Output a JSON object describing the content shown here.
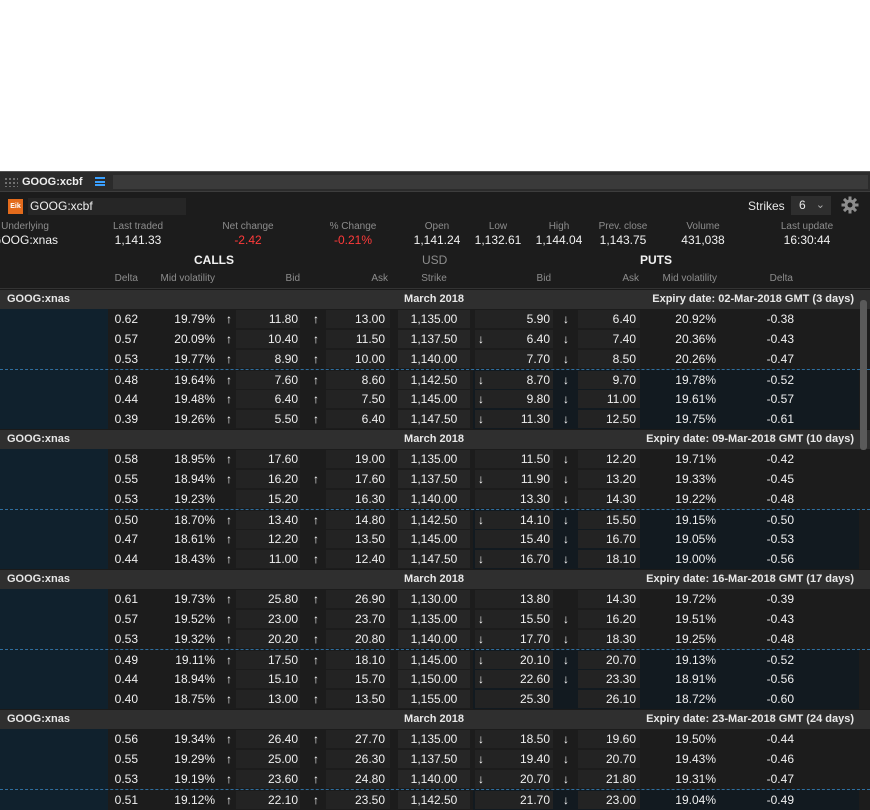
{
  "window": {
    "tab_title": "GOOG:xcbf",
    "symbol": "GOOG:xcbf",
    "logo_text": "Eik"
  },
  "toolbar": {
    "strikes_label": "Strikes",
    "strikes_value": "6"
  },
  "stats": [
    {
      "label": "Underlying",
      "value": "GOOG:xnas"
    },
    {
      "label": "Last traded",
      "value": "1,141.33"
    },
    {
      "label": "Net change",
      "value": "-2.42",
      "negative": true
    },
    {
      "label": "% Change",
      "value": "-0.21%",
      "negative": true
    },
    {
      "label": "Open",
      "value": "1,141.24"
    },
    {
      "label": "Low",
      "value": "1,132.61"
    },
    {
      "label": "High",
      "value": "1,144.04"
    },
    {
      "label": "Prev. close",
      "value": "1,143.75"
    },
    {
      "label": "Volume",
      "value": "431,038"
    },
    {
      "label": "Last update",
      "value": "16:30:44"
    }
  ],
  "sections": {
    "calls": "CALLS",
    "currency": "USD",
    "puts": "PUTS"
  },
  "columns": {
    "delta": "Delta",
    "mid_vol": "Mid volatility",
    "bid": "Bid",
    "ask": "Ask",
    "strike": "Strike",
    "p_bid": "Bid",
    "p_ask": "Ask",
    "p_mid_vol": "Mid volatility",
    "p_delta": "Delta"
  },
  "groups": [
    {
      "underlying": "GOOG:xnas",
      "month": "March 2018",
      "expiry": "Expiry date: 02-Mar-2018 GMT (3 days)",
      "rows": [
        {
          "delta": "0.62",
          "vol": "19.79%",
          "ca1": "up",
          "bid": "11.80",
          "ca2": "up",
          "ask": "13.00",
          "strike": "1,135.00",
          "pa1": "",
          "pbid": "5.90",
          "pa2": "down",
          "pask": "6.40",
          "pvol": "20.92%",
          "pdelta": "-0.38"
        },
        {
          "delta": "0.57",
          "vol": "20.09%",
          "ca1": "up",
          "bid": "10.40",
          "ca2": "up",
          "ask": "11.50",
          "strike": "1,137.50",
          "pa1": "down",
          "pbid": "6.40",
          "pa2": "down",
          "pask": "7.40",
          "pvol": "20.36%",
          "pdelta": "-0.43"
        },
        {
          "delta": "0.53",
          "vol": "19.77%",
          "ca1": "up",
          "bid": "8.90",
          "ca2": "up",
          "ask": "10.00",
          "strike": "1,140.00",
          "pa1": "",
          "pbid": "7.70",
          "pa2": "down",
          "pask": "8.50",
          "pvol": "20.26%",
          "pdelta": "-0.47"
        },
        {
          "delta": "0.48",
          "vol": "19.64%",
          "ca1": "up",
          "bid": "7.60",
          "ca2": "up",
          "ask": "8.60",
          "strike": "1,142.50",
          "pa1": "down",
          "pbid": "8.70",
          "pa2": "down",
          "pask": "9.70",
          "pvol": "19.78%",
          "pdelta": "-0.52"
        },
        {
          "delta": "0.44",
          "vol": "19.48%",
          "ca1": "up",
          "bid": "6.40",
          "ca2": "up",
          "ask": "7.50",
          "strike": "1,145.00",
          "pa1": "down",
          "pbid": "9.80",
          "pa2": "down",
          "pask": "11.00",
          "pvol": "19.61%",
          "pdelta": "-0.57"
        },
        {
          "delta": "0.39",
          "vol": "19.26%",
          "ca1": "up",
          "bid": "5.50",
          "ca2": "up",
          "ask": "6.40",
          "strike": "1,147.50",
          "pa1": "down",
          "pbid": "11.30",
          "pa2": "down",
          "pask": "12.50",
          "pvol": "19.75%",
          "pdelta": "-0.61"
        }
      ]
    },
    {
      "underlying": "GOOG:xnas",
      "month": "March 2018",
      "expiry": "Expiry date: 09-Mar-2018 GMT (10 days)",
      "rows": [
        {
          "delta": "0.58",
          "vol": "18.95%",
          "ca1": "up",
          "bid": "17.60",
          "ca2": "",
          "ask": "19.00",
          "strike": "1,135.00",
          "pa1": "",
          "pbid": "11.50",
          "pa2": "down",
          "pask": "12.20",
          "pvol": "19.71%",
          "pdelta": "-0.42"
        },
        {
          "delta": "0.55",
          "vol": "18.94%",
          "ca1": "up",
          "bid": "16.20",
          "ca2": "up",
          "ask": "17.60",
          "strike": "1,137.50",
          "pa1": "down",
          "pbid": "11.90",
          "pa2": "down",
          "pask": "13.20",
          "pvol": "19.33%",
          "pdelta": "-0.45"
        },
        {
          "delta": "0.53",
          "vol": "19.23%",
          "ca1": "",
          "bid": "15.20",
          "ca2": "",
          "ask": "16.30",
          "strike": "1,140.00",
          "pa1": "",
          "pbid": "13.30",
          "pa2": "down",
          "pask": "14.30",
          "pvol": "19.22%",
          "pdelta": "-0.48"
        },
        {
          "delta": "0.50",
          "vol": "18.70%",
          "ca1": "up",
          "bid": "13.40",
          "ca2": "up",
          "ask": "14.80",
          "strike": "1,142.50",
          "pa1": "down",
          "pbid": "14.10",
          "pa2": "down",
          "pask": "15.50",
          "pvol": "19.15%",
          "pdelta": "-0.50"
        },
        {
          "delta": "0.47",
          "vol": "18.61%",
          "ca1": "up",
          "bid": "12.20",
          "ca2": "up",
          "ask": "13.50",
          "strike": "1,145.00",
          "pa1": "",
          "pbid": "15.40",
          "pa2": "down",
          "pask": "16.70",
          "pvol": "19.05%",
          "pdelta": "-0.53"
        },
        {
          "delta": "0.44",
          "vol": "18.43%",
          "ca1": "up",
          "bid": "11.00",
          "ca2": "up",
          "ask": "12.40",
          "strike": "1,147.50",
          "pa1": "down",
          "pbid": "16.70",
          "pa2": "down",
          "pask": "18.10",
          "pvol": "19.00%",
          "pdelta": "-0.56"
        }
      ]
    },
    {
      "underlying": "GOOG:xnas",
      "month": "March 2018",
      "expiry": "Expiry date: 16-Mar-2018 GMT (17 days)",
      "rows": [
        {
          "delta": "0.61",
          "vol": "19.73%",
          "ca1": "up",
          "bid": "25.80",
          "ca2": "up",
          "ask": "26.90",
          "strike": "1,130.00",
          "pa1": "",
          "pbid": "13.80",
          "pa2": "",
          "pask": "14.30",
          "pvol": "19.72%",
          "pdelta": "-0.39"
        },
        {
          "delta": "0.57",
          "vol": "19.52%",
          "ca1": "up",
          "bid": "23.00",
          "ca2": "up",
          "ask": "23.70",
          "strike": "1,135.00",
          "pa1": "down",
          "pbid": "15.50",
          "pa2": "down",
          "pask": "16.20",
          "pvol": "19.51%",
          "pdelta": "-0.43"
        },
        {
          "delta": "0.53",
          "vol": "19.32%",
          "ca1": "up",
          "bid": "20.20",
          "ca2": "up",
          "ask": "20.80",
          "strike": "1,140.00",
          "pa1": "down",
          "pbid": "17.70",
          "pa2": "down",
          "pask": "18.30",
          "pvol": "19.25%",
          "pdelta": "-0.48"
        },
        {
          "delta": "0.49",
          "vol": "19.11%",
          "ca1": "up",
          "bid": "17.50",
          "ca2": "up",
          "ask": "18.10",
          "strike": "1,145.00",
          "pa1": "down",
          "pbid": "20.10",
          "pa2": "down",
          "pask": "20.70",
          "pvol": "19.13%",
          "pdelta": "-0.52"
        },
        {
          "delta": "0.44",
          "vol": "18.94%",
          "ca1": "up",
          "bid": "15.10",
          "ca2": "up",
          "ask": "15.70",
          "strike": "1,150.00",
          "pa1": "down",
          "pbid": "22.60",
          "pa2": "down",
          "pask": "23.30",
          "pvol": "18.91%",
          "pdelta": "-0.56"
        },
        {
          "delta": "0.40",
          "vol": "18.75%",
          "ca1": "up",
          "bid": "13.00",
          "ca2": "up",
          "ask": "13.50",
          "strike": "1,155.00",
          "pa1": "",
          "pbid": "25.30",
          "pa2": "",
          "pask": "26.10",
          "pvol": "18.72%",
          "pdelta": "-0.60"
        }
      ]
    },
    {
      "underlying": "GOOG:xnas",
      "month": "March 2018",
      "expiry": "Expiry date: 23-Mar-2018 GMT (24 days)",
      "rows": [
        {
          "delta": "0.56",
          "vol": "19.34%",
          "ca1": "up",
          "bid": "26.40",
          "ca2": "up",
          "ask": "27.70",
          "strike": "1,135.00",
          "pa1": "down",
          "pbid": "18.50",
          "pa2": "down",
          "pask": "19.60",
          "pvol": "19.50%",
          "pdelta": "-0.44"
        },
        {
          "delta": "0.55",
          "vol": "19.29%",
          "ca1": "up",
          "bid": "25.00",
          "ca2": "up",
          "ask": "26.30",
          "strike": "1,137.50",
          "pa1": "down",
          "pbid": "19.40",
          "pa2": "down",
          "pask": "20.70",
          "pvol": "19.43%",
          "pdelta": "-0.46"
        },
        {
          "delta": "0.53",
          "vol": "19.19%",
          "ca1": "up",
          "bid": "23.60",
          "ca2": "up",
          "ask": "24.80",
          "strike": "1,140.00",
          "pa1": "down",
          "pbid": "20.70",
          "pa2": "down",
          "pask": "21.80",
          "pvol": "19.31%",
          "pdelta": "-0.47"
        },
        {
          "delta": "0.51",
          "vol": "19.12%",
          "ca1": "up",
          "bid": "22.10",
          "ca2": "up",
          "ask": "23.50",
          "strike": "1,142.50",
          "pa1": "",
          "pbid": "21.70",
          "pa2": "down",
          "pask": "23.00",
          "pvol": "19.04%",
          "pdelta": "-0.49"
        }
      ]
    }
  ]
}
